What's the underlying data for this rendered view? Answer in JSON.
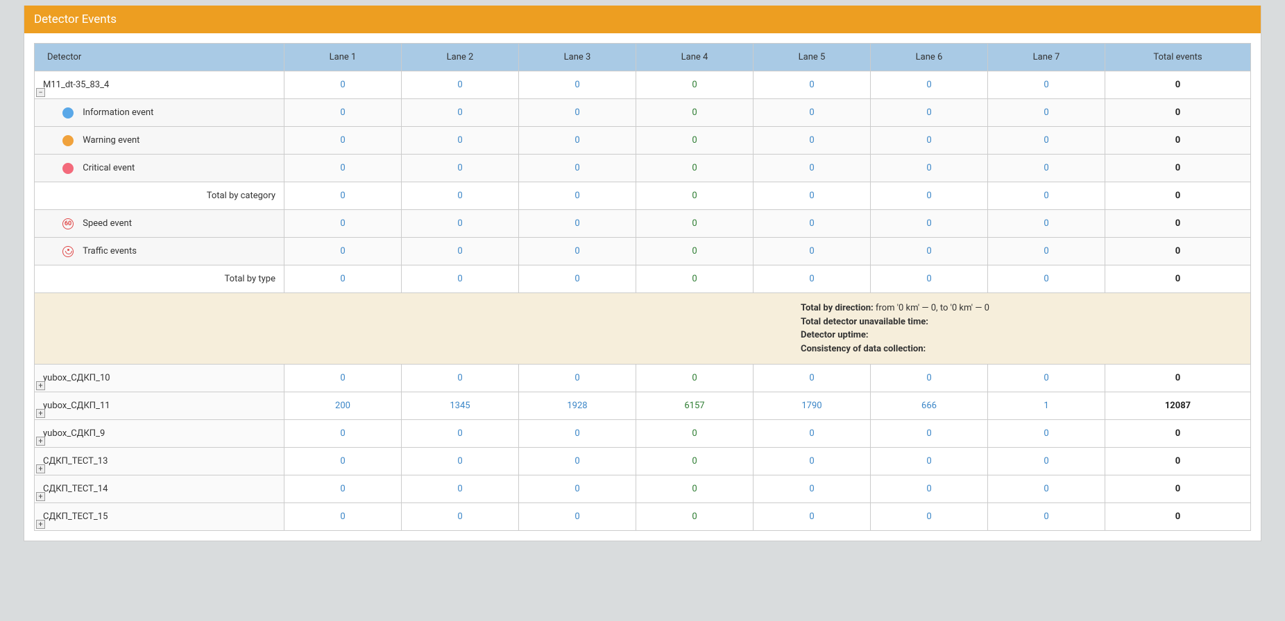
{
  "header": {
    "title": "Detector Events"
  },
  "columns": {
    "detector": "Detector",
    "lanes": [
      "Lane 1",
      "Lane 2",
      "Lane 3",
      "Lane 4",
      "Lane 5",
      "Lane 6",
      "Lane 7"
    ],
    "total": "Total events"
  },
  "labels": {
    "info_event": "Information event",
    "warn_event": "Warning event",
    "crit_event": "Critical event",
    "total_category": "Total by category",
    "speed_event": "Speed event",
    "traffic_events": "Traffic events",
    "total_type": "Total by type",
    "speed_icon_text": "60"
  },
  "toggle": {
    "plus": "+",
    "minus": "−"
  },
  "detectors": [
    {
      "name": "M11_dt-35_83_4",
      "expanded": true,
      "lanes": [
        "0",
        "0",
        "0",
        "0",
        "0",
        "0",
        "0"
      ],
      "total": "0"
    },
    {
      "name": "yubox_СДКП_10",
      "expanded": false,
      "lanes": [
        "0",
        "0",
        "0",
        "0",
        "0",
        "0",
        "0"
      ],
      "total": "0"
    },
    {
      "name": "yubox_СДКП_11",
      "expanded": false,
      "lanes": [
        "200",
        "1345",
        "1928",
        "6157",
        "1790",
        "666",
        "1"
      ],
      "total": "12087"
    },
    {
      "name": "yubox_СДКП_9",
      "expanded": false,
      "lanes": [
        "0",
        "0",
        "0",
        "0",
        "0",
        "0",
        "0"
      ],
      "total": "0"
    },
    {
      "name": "СДКП_ТЕСТ_13",
      "expanded": false,
      "lanes": [
        "0",
        "0",
        "0",
        "0",
        "0",
        "0",
        "0"
      ],
      "total": "0"
    },
    {
      "name": "СДКП_ТЕСТ_14",
      "expanded": false,
      "lanes": [
        "0",
        "0",
        "0",
        "0",
        "0",
        "0",
        "0"
      ],
      "total": "0"
    },
    {
      "name": "СДКП_ТЕСТ_15",
      "expanded": false,
      "lanes": [
        "0",
        "0",
        "0",
        "0",
        "0",
        "0",
        "0"
      ],
      "total": "0"
    }
  ],
  "expanded_detail": {
    "info": {
      "lanes": [
        "0",
        "0",
        "0",
        "0",
        "0",
        "0",
        "0"
      ],
      "total": "0"
    },
    "warn": {
      "lanes": [
        "0",
        "0",
        "0",
        "0",
        "0",
        "0",
        "0"
      ],
      "total": "0"
    },
    "crit": {
      "lanes": [
        "0",
        "0",
        "0",
        "0",
        "0",
        "0",
        "0"
      ],
      "total": "0"
    },
    "cat_total": {
      "lanes": [
        "0",
        "0",
        "0",
        "0",
        "0",
        "0",
        "0"
      ],
      "total": "0"
    },
    "speed": {
      "lanes": [
        "0",
        "0",
        "0",
        "0",
        "0",
        "0",
        "0"
      ],
      "total": "0"
    },
    "traffic": {
      "lanes": [
        "0",
        "0",
        "0",
        "0",
        "0",
        "0",
        "0"
      ],
      "total": "0"
    },
    "type_total": {
      "lanes": [
        "0",
        "0",
        "0",
        "0",
        "0",
        "0",
        "0"
      ],
      "total": "0"
    }
  },
  "info_block": {
    "total_direction_label": "Total by direction:",
    "total_direction_value": " from '0 km' — 0, to '0 km' — 0",
    "unavailable_label": "Total detector unavailable time:",
    "uptime_label": "Detector uptime:",
    "consistency_label": "Consistency of data collection:"
  }
}
